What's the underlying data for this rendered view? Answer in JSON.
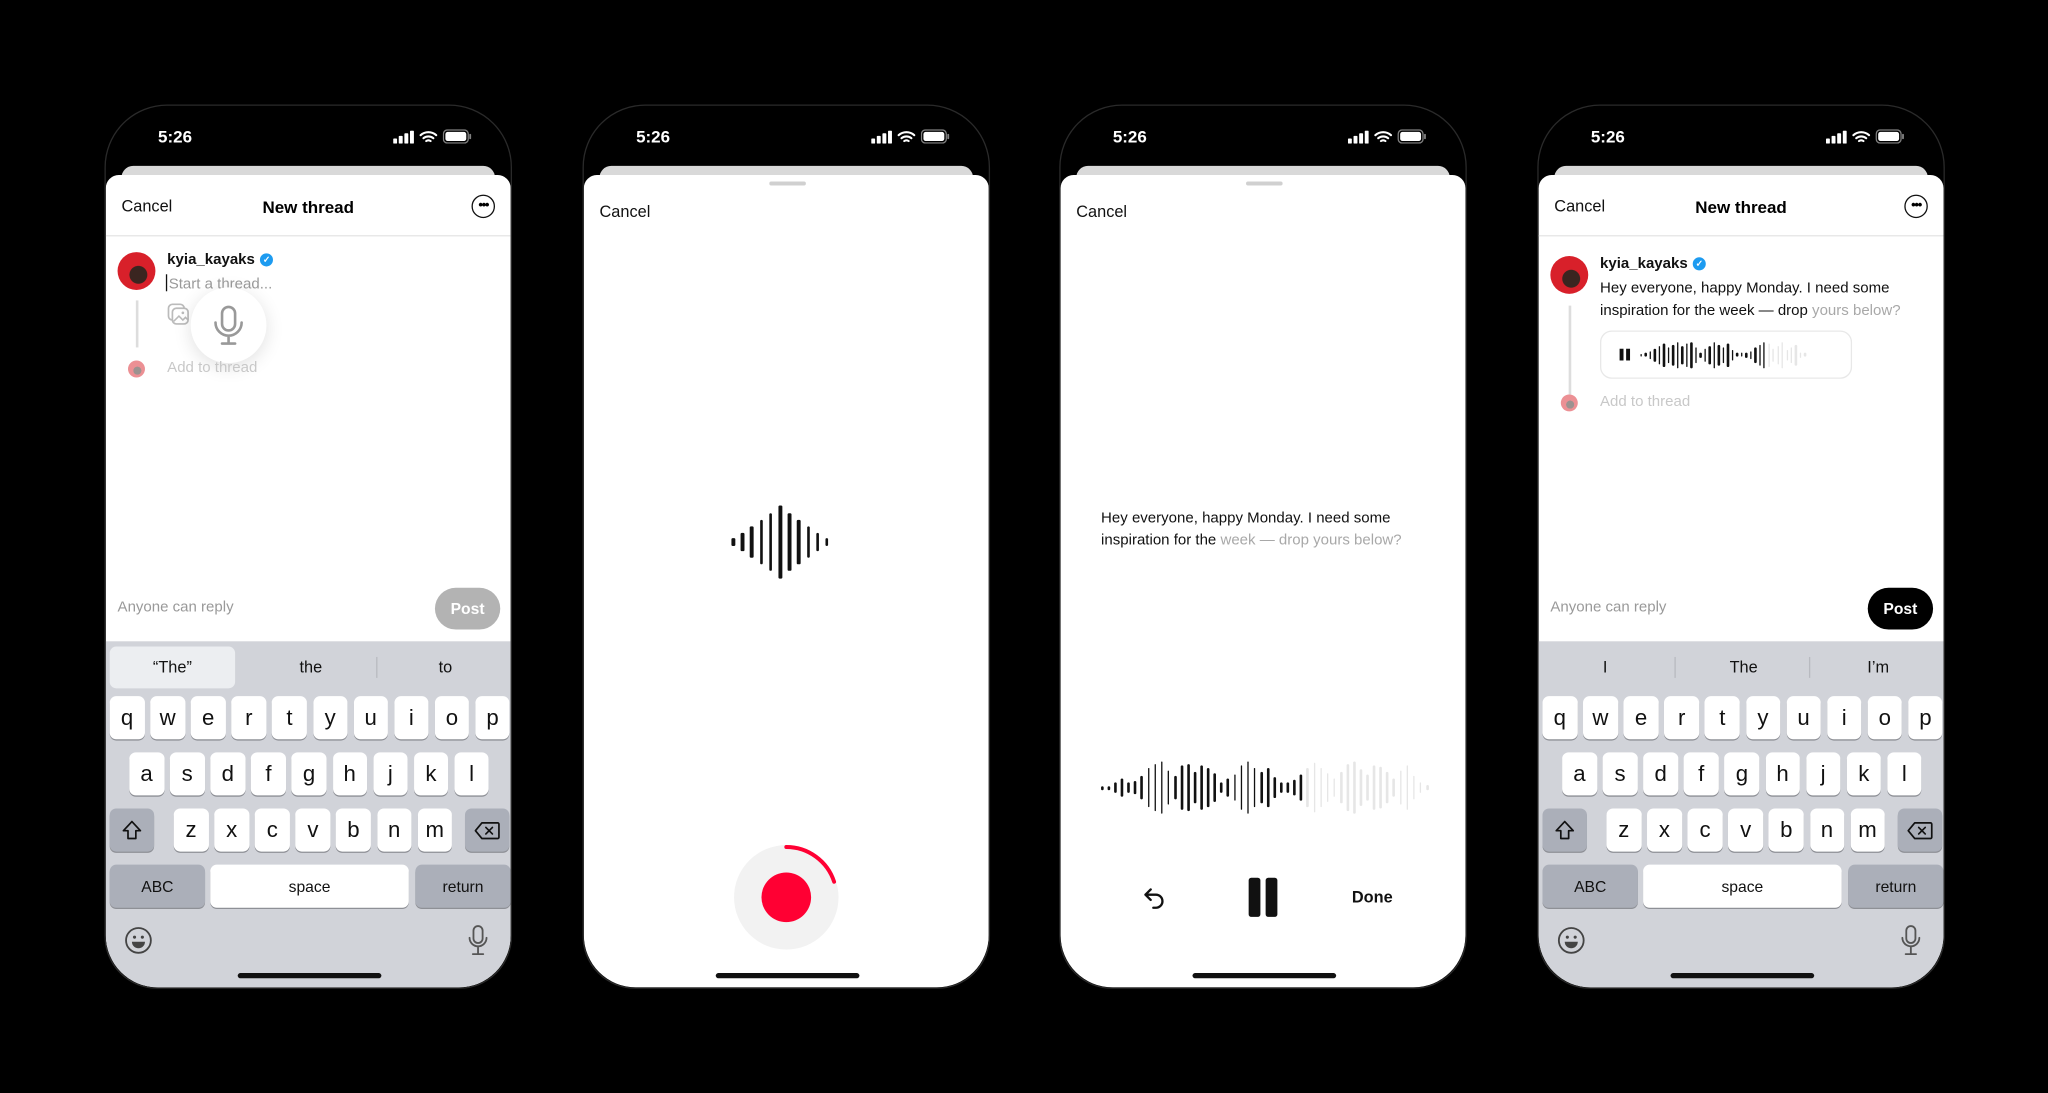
{
  "status": {
    "time": "5:26"
  },
  "colors": {
    "record_red": "#ff0033",
    "verified_blue": "#1d9bf0",
    "post_disabled": "#b3b3b3",
    "post_enabled": "#000000"
  },
  "screens": [
    {
      "header": {
        "cancel": "Cancel",
        "title": "New thread",
        "more_icon": "ellipsis-circle-icon"
      },
      "user": {
        "username": "kyia_kayaks",
        "verified": true
      },
      "composer": {
        "placeholder": "Start a thread...",
        "add_to_thread": "Add to thread"
      },
      "footer": {
        "reply_setting": "Anyone can reply",
        "post": "Post",
        "post_enabled": false
      },
      "keyboard": {
        "suggestions": [
          "“The”",
          "the",
          "to"
        ]
      }
    },
    {
      "header": {
        "cancel": "Cancel"
      },
      "recording": {
        "progress": 0.2
      }
    },
    {
      "header": {
        "cancel": "Cancel"
      },
      "transcript": {
        "spoken": "Hey everyone, happy Monday. I need some inspiration for the ",
        "pending": "week — drop yours below?"
      },
      "playback": {
        "played_fraction": 0.62,
        "done": "Done"
      }
    },
    {
      "header": {
        "cancel": "Cancel",
        "title": "New thread",
        "more_icon": "ellipsis-circle-icon"
      },
      "user": {
        "username": "kyia_kayaks",
        "verified": true
      },
      "composer": {
        "text": "Hey everyone, happy Monday. I need some inspiration for the week — drop ",
        "text_pending": "yours below?",
        "add_to_thread": "Add to thread",
        "audio_played_fraction": 0.75
      },
      "footer": {
        "reply_setting": "Anyone can reply",
        "post": "Post",
        "post_enabled": true
      },
      "keyboard": {
        "suggestions": [
          "I",
          "The",
          "I’m"
        ]
      }
    }
  ],
  "keyboard": {
    "rows": [
      [
        "q",
        "w",
        "e",
        "r",
        "t",
        "y",
        "u",
        "i",
        "o",
        "p"
      ],
      [
        "a",
        "s",
        "d",
        "f",
        "g",
        "h",
        "j",
        "k",
        "l"
      ],
      [
        "z",
        "x",
        "c",
        "v",
        "b",
        "n",
        "m"
      ]
    ],
    "abc": "ABC",
    "space": "space",
    "return": "return"
  }
}
